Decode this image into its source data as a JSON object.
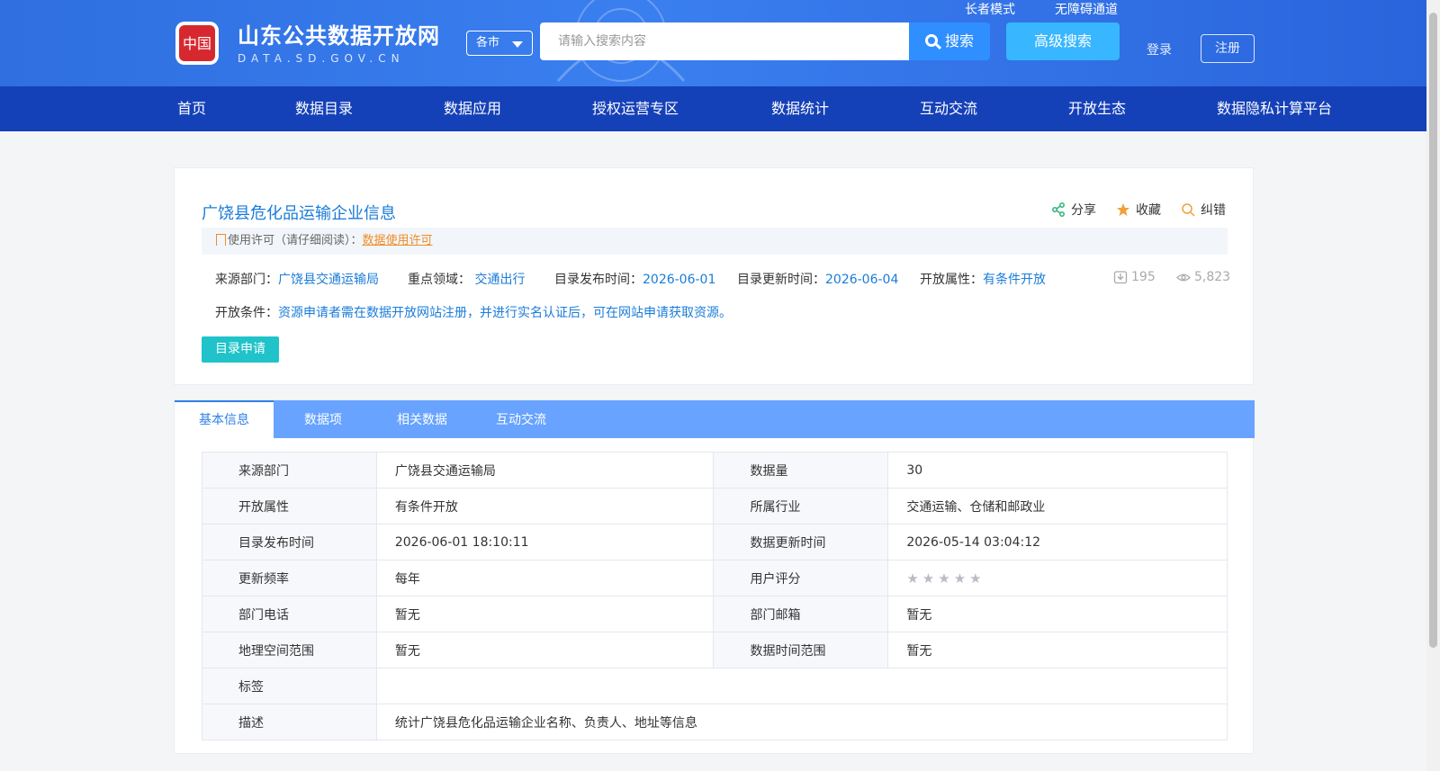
{
  "header": {
    "brand_cn": "山东公共数据开放网",
    "brand_en": "DATA.SD.GOV.CN",
    "city": "各市",
    "search_placeholder": "请输入搜索内容",
    "search_btn": "搜索",
    "advanced_btn": "高级搜索",
    "elder_mode": "长者模式",
    "accessibility": "无障碍通道",
    "login": "登录",
    "register": "注册"
  },
  "nav": [
    "首页",
    "数据目录",
    "数据应用",
    "授权运营专区",
    "数据统计",
    "互动交流",
    "开放生态",
    "数据隐私计算平台"
  ],
  "card": {
    "title": "广饶县危化品运输企业信息",
    "share": "分享",
    "favorite": "收藏",
    "correct": "纠错",
    "license_label": "使用许可（请仔细阅读）：",
    "license_link": "数据使用许可",
    "source_label": "来源部门：",
    "source_value": "广饶县交通运输局",
    "field_label": "重点领域：",
    "field_value": "交通出行",
    "pub_label": "目录发布时间：",
    "pub_value": "2026-06-01",
    "upd_label": "目录更新时间：",
    "upd_value": "2026-06-04",
    "open_label": "开放属性：",
    "open_value": "有条件开放",
    "downloads": "195",
    "views": "5,823",
    "cond_label": "开放条件：",
    "cond_value": "资源申请者需在数据开放网站注册，并进行实名认证后，可在网站申请获取资源。",
    "apply_btn": "目录申请"
  },
  "tabs": [
    "基本信息",
    "数据项",
    "相关数据",
    "互动交流"
  ],
  "info": {
    "r1": {
      "k1": "来源部门",
      "v1": "广饶县交通运输局",
      "k2": "数据量",
      "v2": "30"
    },
    "r2": {
      "k1": "开放属性",
      "v1": "有条件开放",
      "k2": "所属行业",
      "v2": "交通运输、仓储和邮政业"
    },
    "r3": {
      "k1": "目录发布时间",
      "v1": "2026-06-01 18:10:11",
      "k2": "数据更新时间",
      "v2": "2026-05-14 03:04:12"
    },
    "r4": {
      "k1": "更新频率",
      "v1": "每年",
      "k2": "用户评分",
      "rating": 0,
      "rating_max": 5
    },
    "r5": {
      "k1": "部门电话",
      "v1": "暂无",
      "k2": "部门邮箱",
      "v2": "暂无"
    },
    "r6": {
      "k1": "地理空间范围",
      "v1": "暂无",
      "k2": "数据时间范围",
      "v2": "暂无"
    },
    "r7": {
      "k1": "标签",
      "v1": ""
    },
    "r8": {
      "k1": "描述",
      "v1": "统计广饶县危化品运输企业名称、负责人、地址等信息"
    }
  },
  "colors": {
    "nav_bg": "#1541b8",
    "accent": "#1a7cd9",
    "tab_bar": "#67a3ff",
    "apply": "#1fc3c9",
    "license_link": "#f08c26"
  }
}
